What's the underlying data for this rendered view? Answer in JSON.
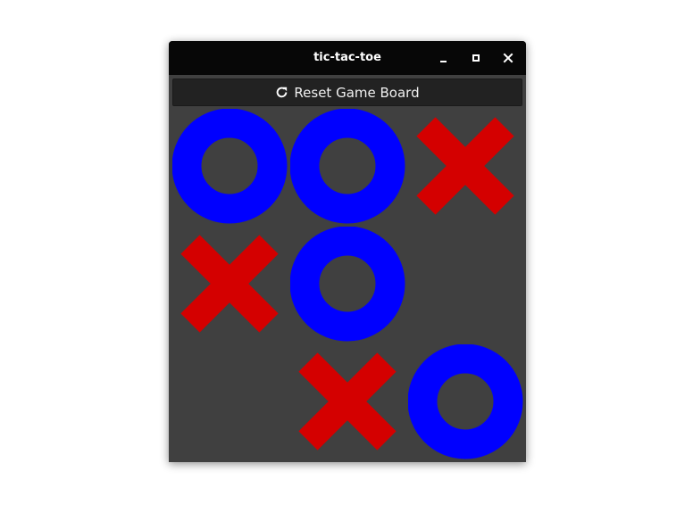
{
  "window": {
    "title": "tic-tac-toe",
    "controls": [
      "minimize-icon",
      "maximize-icon",
      "close-icon"
    ]
  },
  "toolbar": {
    "reset_label": "Reset Game Board",
    "reset_icon": "refresh-icon"
  },
  "colors": {
    "board_bg": "#404040",
    "titlebar_bg": "#070707",
    "o_mark": "#0000ff",
    "x_mark": "#d40000"
  },
  "board": {
    "rows": 3,
    "cols": 3,
    "cells": [
      "O",
      "O",
      "X",
      "X",
      "O",
      "",
      "",
      "X",
      "O"
    ]
  }
}
